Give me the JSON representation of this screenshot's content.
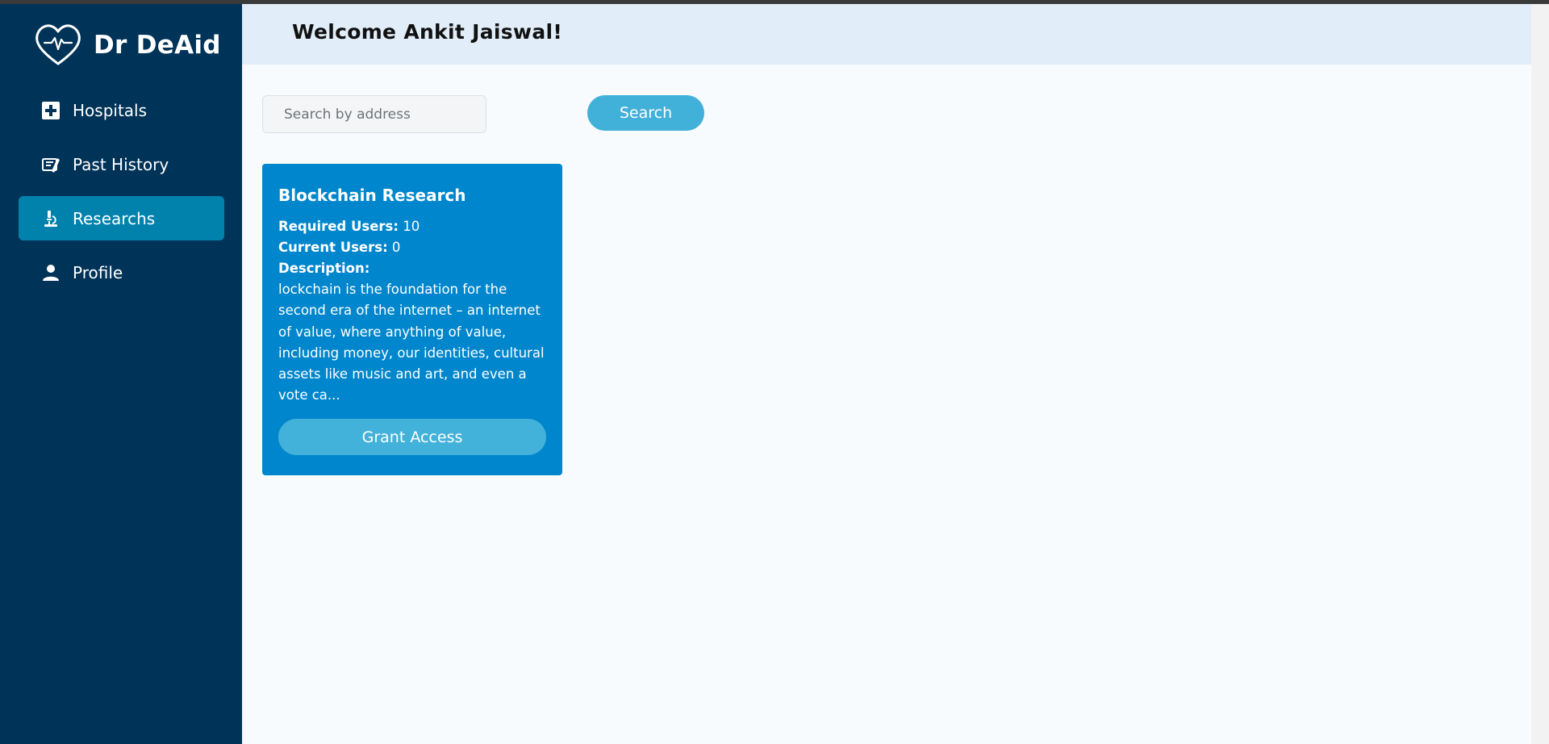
{
  "app": {
    "name": "Dr DeAid"
  },
  "sidebar": {
    "items": [
      {
        "label": "Hospitals",
        "icon": "hospital-plus-icon",
        "active": false
      },
      {
        "label": "Past History",
        "icon": "history-records-icon",
        "active": false
      },
      {
        "label": "Researchs",
        "icon": "microscope-icon",
        "active": true
      },
      {
        "label": "Profile",
        "icon": "user-icon",
        "active": false
      }
    ]
  },
  "header": {
    "title": "Welcome Ankit Jaiswal!"
  },
  "search": {
    "placeholder": "Search by address",
    "value": "",
    "button_label": "Search"
  },
  "research_card": {
    "title": "Blockchain Research",
    "required_users_label": "Required Users:",
    "required_users_value": "10",
    "current_users_label": "Current Users:",
    "current_users_value": "0",
    "description_label": "Description:",
    "description": "lockchain is the foundation for the second era of the internet – an internet of value, where anything of value, including money, our identities, cultural assets like music and art, and even a vote ca...",
    "button_label": "Grant Access"
  },
  "colors": {
    "sidebar_bg": "#003358",
    "active_item": "#0082ad",
    "header_bg": "#e1eef9",
    "card_bg": "#0086cc",
    "button_bg": "#42b1d9"
  }
}
